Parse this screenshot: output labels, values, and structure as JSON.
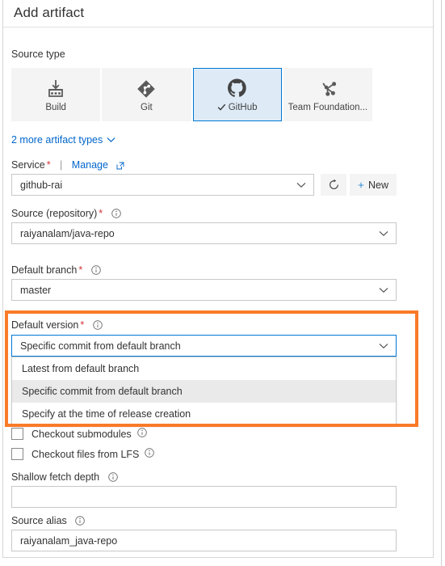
{
  "dialog": {
    "title": "Add artifact"
  },
  "source_type": {
    "label": "Source type",
    "tiles": [
      {
        "label": "Build",
        "icon": "build-icon",
        "selected": false
      },
      {
        "label": "Git",
        "icon": "git-icon",
        "selected": false
      },
      {
        "label": "GitHub",
        "icon": "github-icon",
        "selected": true
      },
      {
        "label": "Team Foundation...",
        "icon": "team-foundation-icon",
        "selected": false
      }
    ],
    "more_link": "2 more artifact types"
  },
  "service": {
    "label": "Service",
    "required": "*",
    "separator": "|",
    "manage_link": "Manage",
    "value": "github-rai",
    "refresh_title": "refresh-icon",
    "new_label": "New"
  },
  "source_repository": {
    "label": "Source (repository)",
    "required": "*",
    "value": "raiyanalam/java-repo"
  },
  "default_branch": {
    "label": "Default branch",
    "required": "*",
    "value": "master"
  },
  "default_version": {
    "label": "Default version",
    "required": "*",
    "value": "Specific commit from default branch",
    "options": [
      {
        "label": "Latest from default branch",
        "active": false
      },
      {
        "label": "Specific commit from default branch",
        "active": true
      },
      {
        "label": "Specify at the time of release creation",
        "active": false
      }
    ]
  },
  "checkboxes": [
    {
      "label": "Checkout submodules",
      "checked": false
    },
    {
      "label": "Checkout files from LFS",
      "checked": false
    }
  ],
  "shallow_fetch_depth": {
    "label": "Shallow fetch depth",
    "value": ""
  },
  "source_alias": {
    "label": "Source alias",
    "value": "raiyanalam_java-repo"
  },
  "colors": {
    "highlight": "#f97b28",
    "accent": "#0078d4",
    "link": "#0066cc",
    "required": "#d13438",
    "tile_bg": "#f4f4f4",
    "tile_selected_bg": "#deebf7",
    "option_active_bg": "#eaeaea"
  }
}
